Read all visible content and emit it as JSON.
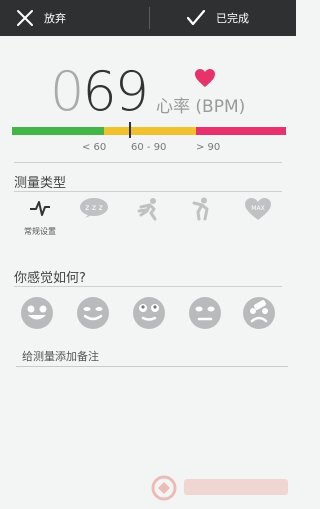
{
  "topbar": {
    "discard_label": "放弃",
    "done_label": "已完成"
  },
  "reading": {
    "value_lead": "0",
    "value_main": "69",
    "unit": "心率 (BPM)"
  },
  "scale": {
    "colors": {
      "low": "#43b549",
      "normal": "#f0c22d",
      "high": "#e8326b"
    },
    "labels": [
      "< 60",
      "60 - 90",
      "> 90"
    ],
    "current_bpm": 69
  },
  "measure_type": {
    "title": "测量类型",
    "items": [
      {
        "icon": "pulse-icon",
        "label": "常规设置",
        "selected": true
      },
      {
        "icon": "sleep-icon",
        "label": "",
        "selected": false
      },
      {
        "icon": "runner-icon",
        "label": "",
        "selected": false
      },
      {
        "icon": "stretch-icon",
        "label": "",
        "selected": false
      },
      {
        "icon": "max-heart-icon",
        "label": "",
        "selected": false,
        "badge": "MAX"
      }
    ]
  },
  "feeling": {
    "title": "你感觉如何?",
    "moods": [
      "happy-face-icon",
      "grin-face-icon",
      "surprised-face-icon",
      "sad-face-icon",
      "sick-face-icon"
    ]
  },
  "note": {
    "placeholder": "给测量添加备注"
  }
}
